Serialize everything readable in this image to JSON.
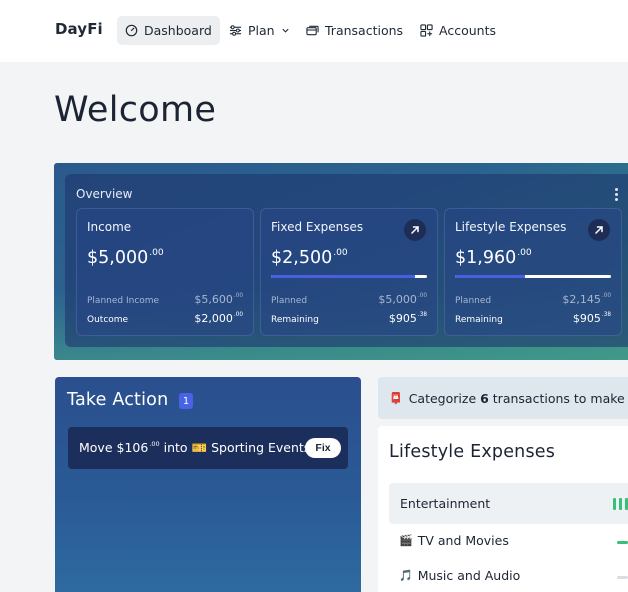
{
  "app": {
    "brand": "DayFi"
  },
  "nav": {
    "dashboard": "Dashboard",
    "plan": "Plan",
    "transactions": "Transactions",
    "accounts": "Accounts"
  },
  "page": {
    "title": "Welcome"
  },
  "overview": {
    "title": "Overview",
    "cards": [
      {
        "title": "Income",
        "amount": "$5,000",
        "amount_cents": ".00",
        "row1_label": "Planned Income",
        "row1_value": "$5,600",
        "row1_cents": ".00",
        "row2_label": "Outcome",
        "row2_value": "$2,000",
        "row2_cents": ".00"
      },
      {
        "title": "Fixed Expenses",
        "amount": "$2,500",
        "amount_cents": ".00",
        "progress": 0.92,
        "row1_label": "Planned",
        "row1_value": "$5,000",
        "row1_cents": ".00",
        "row2_label": "Remaining",
        "row2_value": "$905",
        "row2_cents": ".38"
      },
      {
        "title": "Lifestyle Expenses",
        "amount": "$1,960",
        "amount_cents": ".00",
        "progress": 0.45,
        "row1_label": "Planned",
        "row1_value": "$2,145",
        "row1_cents": ".00",
        "row2_label": "Remaining",
        "row2_value": "$905",
        "row2_cents": ".38"
      }
    ]
  },
  "take_action": {
    "title": "Take Action",
    "badge": "1",
    "item": {
      "prefix": "Move $106",
      "cents": ".00",
      "mid": " into ",
      "emoji": "🎫",
      "target": " Sporting Events",
      "button": "Fix"
    }
  },
  "banner": {
    "emoji": "📮",
    "pre": "Categorize ",
    "count": "6",
    "post": " transactions to make your"
  },
  "lifestyle": {
    "title": "Lifestyle Expenses",
    "category": "Entertainment",
    "items": [
      {
        "emoji": "🎬",
        "label": "TV and Movies"
      },
      {
        "emoji": "🎵",
        "label": "Music and Audio"
      }
    ]
  },
  "colors": {
    "accent": "#4a5fe0",
    "green": "#37c07a",
    "band": "#2b6390"
  }
}
